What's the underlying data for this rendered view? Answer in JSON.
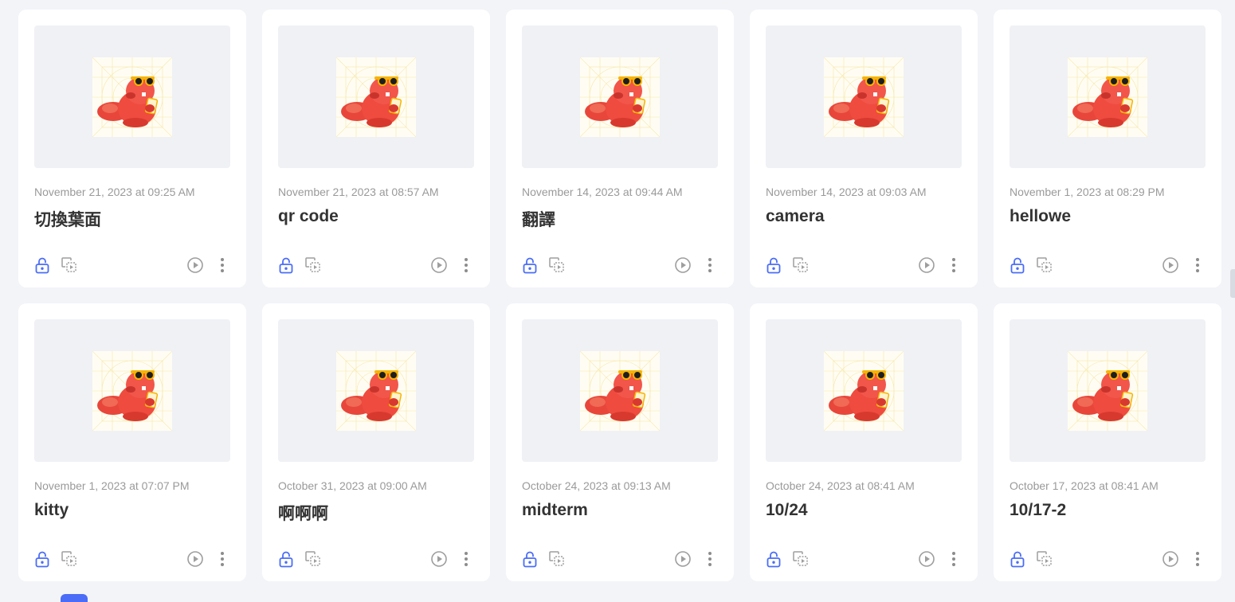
{
  "colors": {
    "background": "#f3f4f8",
    "card": "#ffffff",
    "thumbnail_bg": "#f0f1f5",
    "accent_blue": "#4a6cf7",
    "icon_gray": "#9e9e9e",
    "mascot_red": "#ef4b3f"
  },
  "icons": {
    "thumbnail": "beaver-mascot-icon",
    "lock": "lock-open-icon",
    "duplicate": "duplicate-icon",
    "play": "play-icon",
    "more": "more-vertical-icon"
  },
  "projects": [
    {
      "date": "November 21, 2023 at 09:25 AM",
      "title": "切換葉面"
    },
    {
      "date": "November 21, 2023 at 08:57 AM",
      "title": "qr code"
    },
    {
      "date": "November 14, 2023 at 09:44 AM",
      "title": "翻譯"
    },
    {
      "date": "November 14, 2023 at 09:03 AM",
      "title": "camera"
    },
    {
      "date": "November 1, 2023 at 08:29 PM",
      "title": "hellowe"
    },
    {
      "date": "November 1, 2023 at 07:07 PM",
      "title": "kitty"
    },
    {
      "date": "October 31, 2023 at 09:00 AM",
      "title": "啊啊啊"
    },
    {
      "date": "October 24, 2023 at 09:13 AM",
      "title": "midterm"
    },
    {
      "date": "October 24, 2023 at 08:41 AM",
      "title": "10/24"
    },
    {
      "date": "October 17, 2023 at 08:41 AM",
      "title": "10/17-2"
    }
  ]
}
